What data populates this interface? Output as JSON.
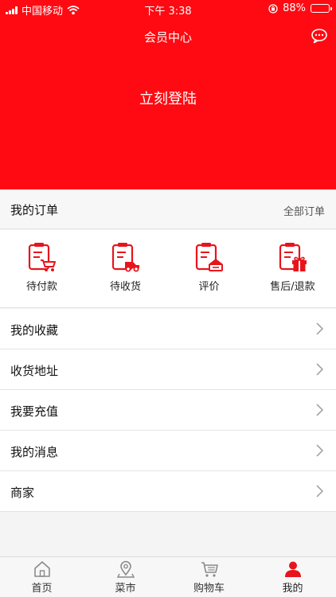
{
  "status": {
    "carrier": "中国移动",
    "time": "下午 3:38",
    "battery": "88%",
    "battery_level": 0.88
  },
  "header": {
    "title": "会员中心",
    "login_label": "立刻登陆",
    "chat_icon": "chat-bubble-icon"
  },
  "orders": {
    "title": "我的订单",
    "all_label": "全部订单",
    "items": [
      {
        "label": "待付款",
        "icon": "pending-payment-icon"
      },
      {
        "label": "待收货",
        "icon": "pending-delivery-icon"
      },
      {
        "label": "评价",
        "icon": "review-icon"
      },
      {
        "label": "售后/退款",
        "icon": "after-sale-refund-icon"
      }
    ]
  },
  "menu": [
    {
      "label": "我的收藏"
    },
    {
      "label": "收货地址"
    },
    {
      "label": "我要充值"
    },
    {
      "label": "我的消息"
    },
    {
      "label": "商家"
    }
  ],
  "tabbar": [
    {
      "label": "首页",
      "icon": "home-icon"
    },
    {
      "label": "菜市",
      "icon": "location-pin-icon"
    },
    {
      "label": "购物车",
      "icon": "cart-icon"
    },
    {
      "label": "我的",
      "icon": "user-icon",
      "active": true
    }
  ],
  "colors": {
    "brand_red": "#ff0a12",
    "icon_red": "#e8141c",
    "page_bg": "#f4f4f4"
  }
}
